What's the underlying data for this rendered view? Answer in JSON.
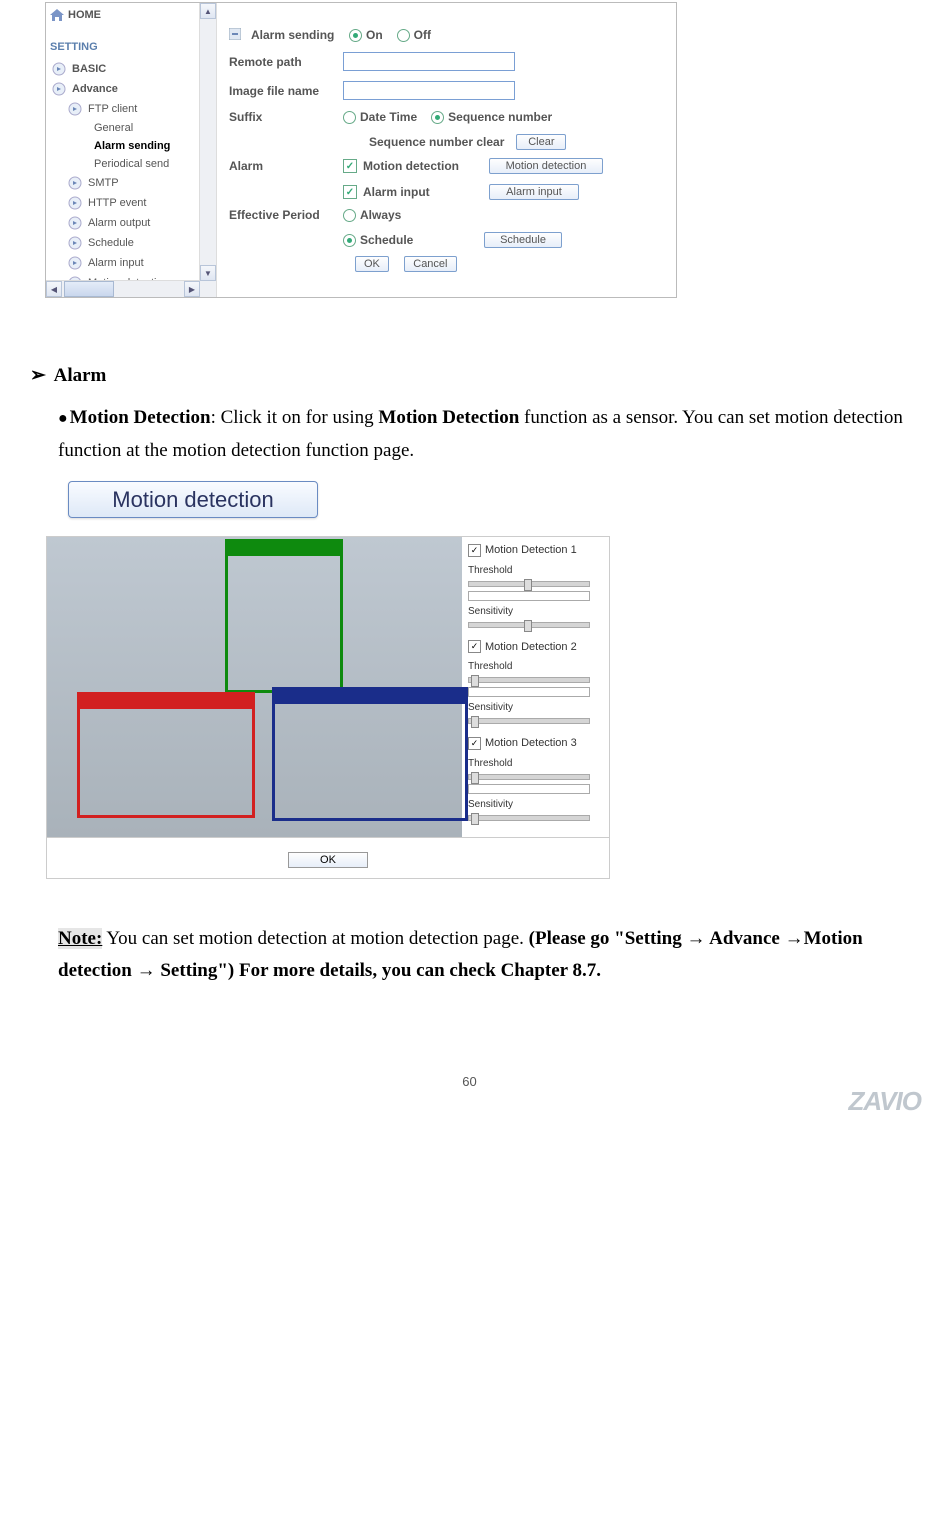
{
  "sidebar": {
    "home": "HOME",
    "setting": "SETTING",
    "basic": "BASIC",
    "advance": "Advance",
    "ftp": "FTP client",
    "general": "General",
    "alarm_sending": "Alarm sending",
    "periodical": "Periodical send",
    "smtp": "SMTP",
    "http_event": "HTTP event",
    "alarm_output": "Alarm output",
    "schedule": "Schedule",
    "alarm_input": "Alarm input",
    "motion_detection": "Motion detection"
  },
  "panel": {
    "alarm_sending": "Alarm sending",
    "on": "On",
    "off": "Off",
    "remote_path": "Remote path",
    "image_file_name": "Image file name",
    "suffix": "Suffix",
    "date_time": "Date Time",
    "sequence_number": "Sequence number",
    "seq_clear_label": "Sequence number clear",
    "clear": "Clear",
    "alarm": "Alarm",
    "motion_detection_lbl": "Motion detection",
    "motion_detection_btn": "Motion detection",
    "alarm_input_lbl": "Alarm input",
    "alarm_input_btn": "Alarm input",
    "effective_period": "Effective Period",
    "always": "Always",
    "schedule": "Schedule",
    "schedule_btn": "Schedule",
    "ok": "OK",
    "cancel": "Cancel"
  },
  "doc": {
    "section": "Alarm",
    "motion_bold": "Motion Detection",
    "motion_text1": ": Click it on for using ",
    "motion_bold2": "Motion Detection",
    "motion_text2": " function as a sensor. You can set motion detection function at the motion detection function page.",
    "md_button": "Motion detection",
    "note_label": "Note:",
    "note_text1": " You can set motion detection at motion detection page. ",
    "note_bold": "(Please go \"Setting → Advance →Motion detection → Setting\") For more details, you can check Chapter 8.7."
  },
  "md_config": {
    "g1": "Motion Detection 1",
    "g2": "Motion Detection 2",
    "g3": "Motion Detection 3",
    "threshold": "Threshold",
    "sensitivity": "Sensitivity",
    "ok": "OK"
  },
  "page_number": "60",
  "logo": "ZAVIO"
}
